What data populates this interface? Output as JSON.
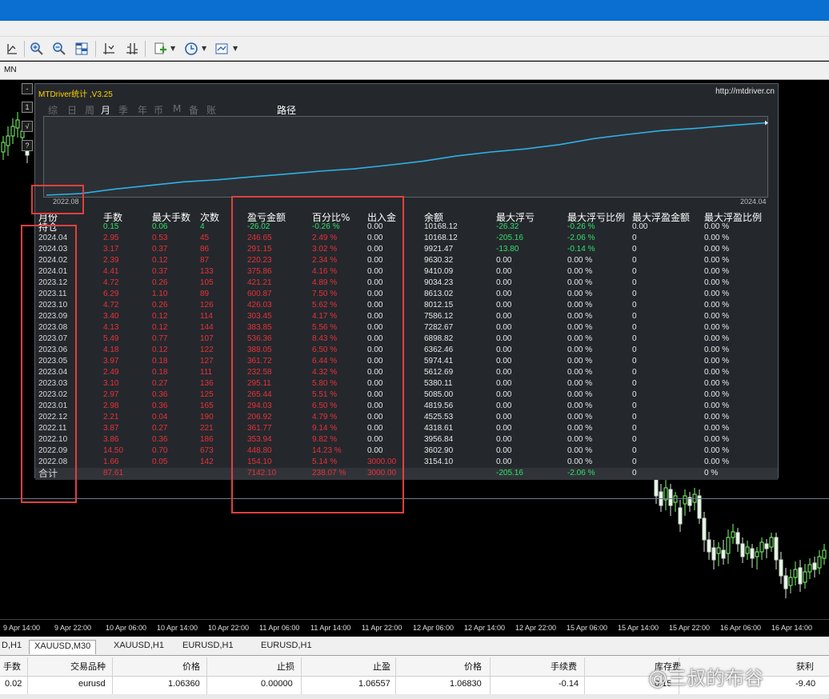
{
  "toolbar": {
    "timeframe": "MN",
    "icons": [
      "line-tool-icon",
      "zoom-in-icon",
      "zoom-out-icon",
      "tile-windows-icon",
      "period-separator-icon",
      "autoscroll-icon",
      "indicator-add-icon",
      "clock-icon",
      "template-icon"
    ]
  },
  "side_buttons": [
    "-",
    "1",
    "√",
    "?"
  ],
  "panel": {
    "title": "MTDriver统计 ,V3.25",
    "url": "http://mtdriver.cn",
    "tabs": [
      "综",
      "日",
      "周",
      "月",
      "季",
      "年",
      "币",
      "M",
      "备",
      "账户"
    ],
    "active_tab": "月",
    "route_label": "路径",
    "curve_start_label": "2022.08",
    "curve_end_label": "2024.04",
    "headers": [
      "月份",
      "手数",
      "最大手数",
      "次数",
      "盈亏金额",
      "百分比%",
      "出入金",
      "余额",
      "最大浮亏",
      "最大浮亏比例",
      "最大浮盈金额",
      "最大浮盈比例"
    ],
    "holding": [
      "持仓",
      "0.15",
      "0.06",
      "4",
      "-26.02",
      "-0.26 %",
      "0.00",
      "10168.12",
      "-26.32",
      "-0.26 %",
      "0.00",
      "0.00 %"
    ],
    "rows": [
      [
        "2024.04",
        "2.95",
        "0.53",
        "45",
        "246.65",
        "2.49 %",
        "0.00",
        "10168.12",
        "-205.16",
        "-2.06 %",
        "0",
        "0.00 %"
      ],
      [
        "2024.03",
        "3.17",
        "0.37",
        "86",
        "291.15",
        "3.02 %",
        "0.00",
        "9921.47",
        "-13.80",
        "-0.14 %",
        "0",
        "0.00 %"
      ],
      [
        "2024.02",
        "2.39",
        "0.12",
        "87",
        "220.23",
        "2.34 %",
        "0.00",
        "9630.32",
        "0.00",
        "0.00 %",
        "0",
        "0.00 %"
      ],
      [
        "2024.01",
        "4.41",
        "0.37",
        "133",
        "375.86",
        "4.16 %",
        "0.00",
        "9410.09",
        "0.00",
        "0.00 %",
        "0",
        "0.00 %"
      ],
      [
        "2023.12",
        "4.72",
        "0.26",
        "105",
        "421.21",
        "4.89 %",
        "0.00",
        "9034.23",
        "0.00",
        "0.00 %",
        "0",
        "0.00 %"
      ],
      [
        "2023.11",
        "6.29",
        "1.10",
        "89",
        "600.87",
        "7.50 %",
        "0.00",
        "8613.02",
        "0.00",
        "0.00 %",
        "0",
        "0.00 %"
      ],
      [
        "2023.10",
        "4.72",
        "0.26",
        "126",
        "426.03",
        "5.62 %",
        "0.00",
        "8012.15",
        "0.00",
        "0.00 %",
        "0",
        "0.00 %"
      ],
      [
        "2023.09",
        "3.40",
        "0.12",
        "114",
        "303.45",
        "4.17 %",
        "0.00",
        "7586.12",
        "0.00",
        "0.00 %",
        "0",
        "0.00 %"
      ],
      [
        "2023.08",
        "4.13",
        "0.12",
        "144",
        "383.85",
        "5.56 %",
        "0.00",
        "7282.67",
        "0.00",
        "0.00 %",
        "0",
        "0.00 %"
      ],
      [
        "2023.07",
        "5.49",
        "0.77",
        "107",
        "536.36",
        "8.43 %",
        "0.00",
        "6898.82",
        "0.00",
        "0.00 %",
        "0",
        "0.00 %"
      ],
      [
        "2023.06",
        "4.18",
        "0.12",
        "122",
        "388.05",
        "6.50 %",
        "0.00",
        "6362.46",
        "0.00",
        "0.00 %",
        "0",
        "0.00 %"
      ],
      [
        "2023.05",
        "3.97",
        "0.18",
        "127",
        "361.72",
        "6.44 %",
        "0.00",
        "5974.41",
        "0.00",
        "0.00 %",
        "0",
        "0.00 %"
      ],
      [
        "2023.04",
        "2.49",
        "0.18",
        "111",
        "232.58",
        "4.32 %",
        "0.00",
        "5612.69",
        "0.00",
        "0.00 %",
        "0",
        "0.00 %"
      ],
      [
        "2023.03",
        "3.10",
        "0.27",
        "136",
        "295.11",
        "5.80 %",
        "0.00",
        "5380.11",
        "0.00",
        "0.00 %",
        "0",
        "0.00 %"
      ],
      [
        "2023.02",
        "2.97",
        "0.36",
        "125",
        "265.44",
        "5.51 %",
        "0.00",
        "5085.00",
        "0.00",
        "0.00 %",
        "0",
        "0.00 %"
      ],
      [
        "2023.01",
        "2.98",
        "0.36",
        "165",
        "294.03",
        "6.50 %",
        "0.00",
        "4819.56",
        "0.00",
        "0.00 %",
        "0",
        "0.00 %"
      ],
      [
        "2022.12",
        "2.21",
        "0.04",
        "190",
        "206.92",
        "4.79 %",
        "0.00",
        "4525.53",
        "0.00",
        "0.00 %",
        "0",
        "0.00 %"
      ],
      [
        "2022.11",
        "3.87",
        "0.27",
        "221",
        "361.77",
        "9.14 %",
        "0.00",
        "4318.61",
        "0.00",
        "0.00 %",
        "0",
        "0.00 %"
      ],
      [
        "2022.10",
        "3.86",
        "0.36",
        "186",
        "353.94",
        "9.82 %",
        "0.00",
        "3956.84",
        "0.00",
        "0.00 %",
        "0",
        "0.00 %"
      ],
      [
        "2022.09",
        "14.50",
        "0.70",
        "673",
        "448.80",
        "14.23 %",
        "0.00",
        "3602.90",
        "0.00",
        "0.00 %",
        "0",
        "0.00 %"
      ],
      [
        "2022.08",
        "1.66",
        "0.05",
        "142",
        "154.10",
        "5.14 %",
        "3000.00",
        "3154.10",
        "0.00",
        "0.00 %",
        "0",
        "0.00 %"
      ]
    ],
    "total": [
      "合计",
      "87.61",
      "",
      "",
      "7142.10",
      "238.07 %",
      "3000.00",
      "",
      "-205.16",
      "-2.06 %",
      "0",
      "0 %"
    ]
  },
  "colors": {
    "title": "#ffd200",
    "red_value": "#e8323a",
    "green_value": "#2fe06a",
    "curve": "#2fb0e6",
    "annotation_box": "#e0403f"
  },
  "time_axis": [
    "9 Apr 14:00",
    "9 Apr 22:00",
    "10 Apr 06:00",
    "10 Apr 14:00",
    "10 Apr 22:00",
    "11 Apr 06:00",
    "11 Apr 14:00",
    "11 Apr 22:00",
    "12 Apr 06:00",
    "12 Apr 14:00",
    "12 Apr 22:00",
    "15 Apr 06:00",
    "15 Apr 14:00",
    "15 Apr 22:00",
    "16 Apr 06:00",
    "16 Apr 14:00"
  ],
  "chart_tabs": [
    "D,H1",
    "XAUUSD,M30",
    "XAUUSD,H1",
    "EURUSD,H1",
    "EURUSD,H1"
  ],
  "orders": {
    "headers": [
      "手数",
      "交易品种",
      "价格",
      "止损",
      "止盈",
      "价格",
      "手续费",
      "库存费",
      "获利"
    ],
    "row": [
      "0.02",
      "eurusd",
      "1.06360",
      "0.00000",
      "1.06557",
      "1.06830",
      "-0.14",
      "0.15",
      "-9.40"
    ]
  },
  "watermark": "@三叔的布谷"
}
